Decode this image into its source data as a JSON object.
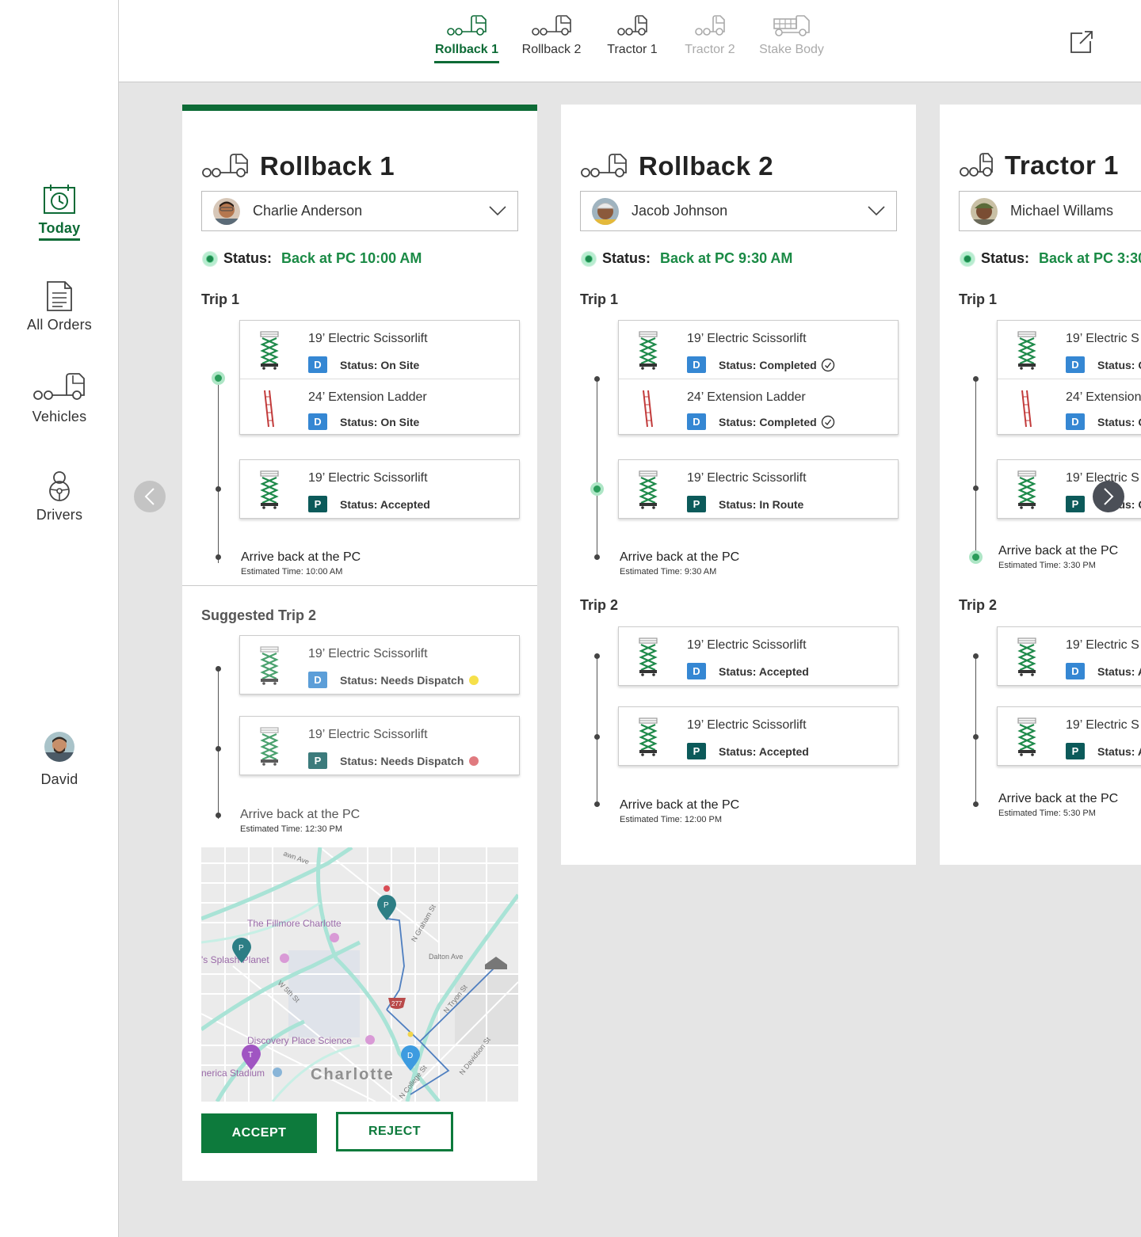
{
  "sidebar": {
    "items": [
      {
        "label": "Today",
        "icon": "calendar-clock-icon"
      },
      {
        "label": "All Orders",
        "icon": "document-icon"
      },
      {
        "label": "Vehicles",
        "icon": "truck-icon"
      },
      {
        "label": "Drivers",
        "icon": "steering-wheel-icon"
      }
    ],
    "user": {
      "label": "David"
    }
  },
  "topbar": {
    "tabs": [
      {
        "label": "Rollback 1",
        "state": "active"
      },
      {
        "label": "Rollback 2",
        "state": "normal"
      },
      {
        "label": "Tractor 1",
        "state": "normal"
      },
      {
        "label": "Tractor 2",
        "state": "disabled"
      },
      {
        "label": "Stake Body",
        "state": "disabled"
      }
    ],
    "popout_icon": "external-link-icon"
  },
  "colors": {
    "accent": "#0d6b36",
    "status_green": "#1a8a45",
    "badge_d": "#3587d3",
    "badge_p": "#0c5a5a",
    "needs_dispatch_yellow": "#f6e04a",
    "needs_dispatch_red": "#e07a7f",
    "accept_button": "#0d7a3c"
  },
  "cards": [
    {
      "title": "Rollback 1",
      "driver": "Charlie Anderson",
      "status_label": "Status:",
      "status_value": "Back at PC 10:00 AM",
      "trip1": {
        "label": "Trip 1",
        "group1": [
          {
            "name": "19’ Electric Scissorlift",
            "badge": "D",
            "status": "Status: On Site"
          },
          {
            "name": "24’ Extension Ladder",
            "badge": "D",
            "status": "Status: On Site"
          }
        ],
        "group2": [
          {
            "name": "19’ Electric Scissorlift",
            "badge": "P",
            "status": "Status: Accepted"
          }
        ],
        "arrive": "Arrive back at the PC",
        "eta": "Estimated Time: 10:00 AM"
      },
      "trip2": {
        "label": "Suggested Trip 2",
        "group1": [
          {
            "name": "19’ Electric Scissorlift",
            "badge": "D",
            "status": "Status: Needs Dispatch"
          }
        ],
        "group2": [
          {
            "name": "19’ Electric Scissorlift",
            "badge": "P",
            "status": "Status: Needs Dispatch"
          }
        ],
        "arrive": "Arrive back at the PC",
        "eta": "Estimated Time: 12:30 PM"
      },
      "map": {
        "labels": [
          "The Fillmore Charlotte",
          "'s Splash Planet",
          "Discovery Place Science",
          "nerica Stadium",
          "Charlotte",
          "Dalton Ave",
          "N Graham St",
          "W 5th St",
          "N Tryon St",
          "N Davidson St",
          "N College St",
          "277",
          "awn Ave"
        ],
        "pins": [
          "P",
          "P",
          "D",
          "T"
        ]
      },
      "buttons": {
        "accept": "ACCEPT",
        "reject": "REJECT"
      }
    },
    {
      "title": "Rollback 2",
      "driver": "Jacob Johnson",
      "status_label": "Status:",
      "status_value": "Back at PC 9:30 AM",
      "trip1": {
        "label": "Trip 1",
        "group1": [
          {
            "name": "19’ Electric Scissorlift",
            "badge": "D",
            "status": "Status: Completed"
          },
          {
            "name": "24’ Extension Ladder",
            "badge": "D",
            "status": "Status: Completed"
          }
        ],
        "group2": [
          {
            "name": "19’ Electric Scissorlift",
            "badge": "P",
            "status": "Status: In Route"
          }
        ],
        "arrive": "Arrive back at the PC",
        "eta": "Estimated Time: 9:30 AM"
      },
      "trip2": {
        "label": "Trip 2",
        "group1": [
          {
            "name": "19’ Electric Scissorlift",
            "badge": "D",
            "status": "Status: Accepted"
          }
        ],
        "group2": [
          {
            "name": "19’ Electric Scissorlift",
            "badge": "P",
            "status": "Status: Accepted"
          }
        ],
        "arrive": "Arrive back at the PC",
        "eta": "Estimated Time: 12:00 PM"
      }
    },
    {
      "title": "Tractor 1",
      "driver": "Michael Willams",
      "status_label": "Status:",
      "status_value": "Back at PC 3:30",
      "trip1": {
        "label": "Trip 1",
        "group1": [
          {
            "name": "19’ Electric S",
            "badge": "D",
            "status": "Status: C"
          },
          {
            "name": "24’ Extension",
            "badge": "D",
            "status": "Status: C"
          }
        ],
        "group2": [
          {
            "name": "19’ Electric S",
            "badge": "P",
            "status": "Status: C"
          }
        ],
        "arrive": "Arrive back at the PC",
        "eta": "Estimated Time: 3:30 PM"
      },
      "trip2": {
        "label": "Trip 2",
        "group1": [
          {
            "name": "19’ Electric S",
            "badge": "D",
            "status": "Status: A"
          }
        ],
        "group2": [
          {
            "name": "19’ Electric S",
            "badge": "P",
            "status": "Status: A"
          }
        ],
        "arrive": "Arrive back at the PC",
        "eta": "Estimated Time: 5:30 PM"
      }
    }
  ],
  "navigation": {
    "prev_icon": "chevron-left-icon",
    "next_icon": "chevron-right-icon"
  }
}
